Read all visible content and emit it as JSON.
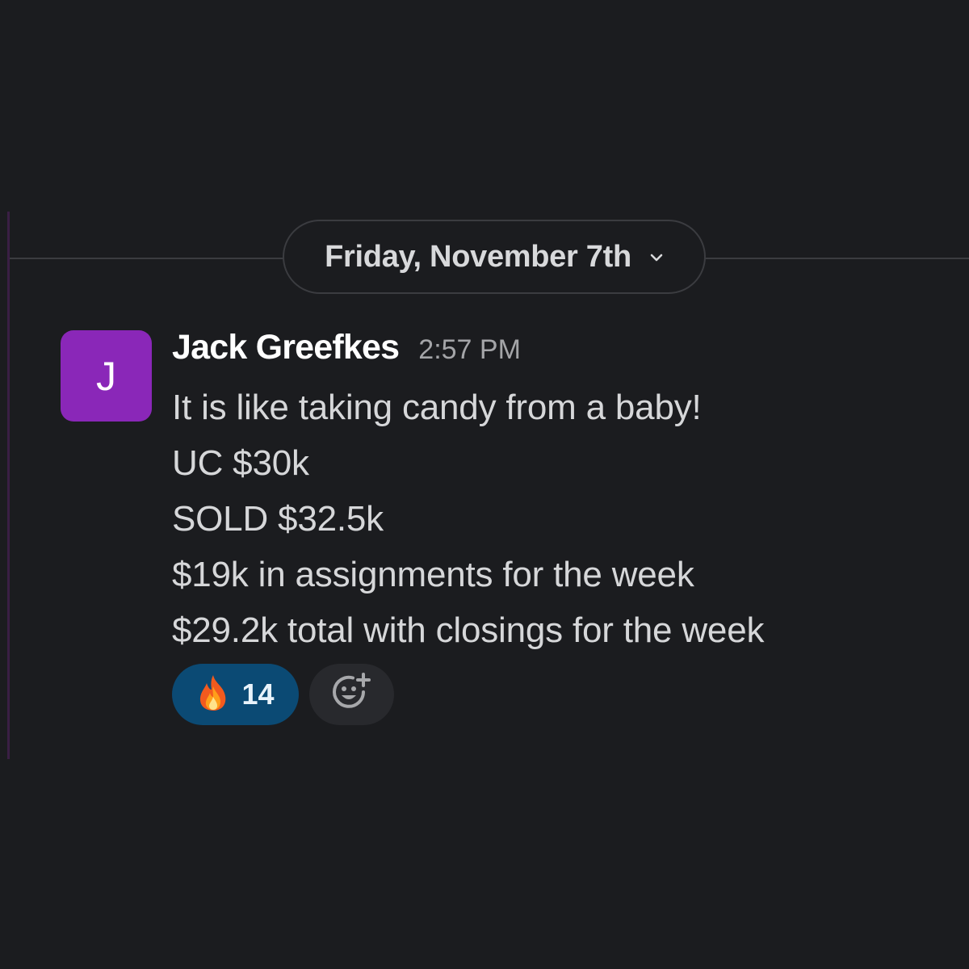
{
  "colors": {
    "background": "#1b1c1f",
    "avatar": "#8a27b8",
    "reaction_active": "#0b4a74",
    "divider": "#3b3c40"
  },
  "date_divider": {
    "label": "Friday, November 7th",
    "icon": "chevron-down-icon"
  },
  "message": {
    "avatar_initial": "J",
    "sender": "Jack Greefkes",
    "timestamp": "2:57 PM",
    "lines": [
      "It is like taking candy from a baby!",
      "UC $30k",
      "SOLD $32.5k",
      "$19k in assignments for the week",
      "$29.2k total with closings for the week"
    ]
  },
  "reactions": [
    {
      "emoji": "fire-icon",
      "count": "14"
    }
  ],
  "add_reaction": {
    "icon": "add-emoji-icon"
  }
}
